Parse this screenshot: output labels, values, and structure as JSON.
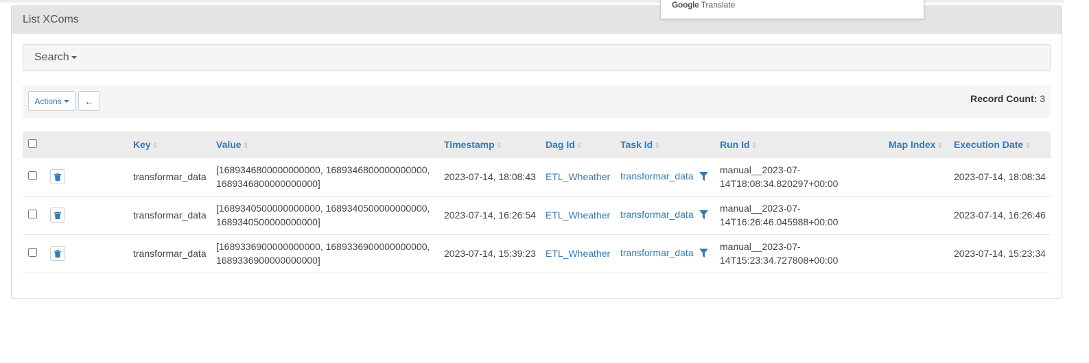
{
  "panel": {
    "title": "List XComs"
  },
  "search": {
    "label": "Search"
  },
  "toolbar": {
    "actions_label": "Actions",
    "back_label": "←",
    "record_count_label": "Record Count:",
    "record_count_value": "3"
  },
  "popup": {
    "google": "Google",
    "translate": "Translate"
  },
  "table": {
    "columns": [
      "Key",
      "Value",
      "Timestamp",
      "Dag Id",
      "Task Id",
      "Run Id",
      "Map Index",
      "Execution Date"
    ],
    "rows": [
      {
        "key": "transformar_data",
        "value_line1": "[1689346800000000000, 1689346800000000000,",
        "value_line2": "1689346800000000000]",
        "timestamp": "2023-07-14, 18:08:43",
        "dag_id": "ETL_Wheather",
        "task_id": "transformar_data",
        "run_id_line1": "manual__2023-07-",
        "run_id_line2": "14T18:08:34.820297+00:00",
        "map_index": "",
        "execution_date": "2023-07-14, 18:08:34"
      },
      {
        "key": "transformar_data",
        "value_line1": "[1689340500000000000, 1689340500000000000,",
        "value_line2": "1689340500000000000]",
        "timestamp": "2023-07-14, 16:26:54",
        "dag_id": "ETL_Wheather",
        "task_id": "transformar_data",
        "run_id_line1": "manual__2023-07-",
        "run_id_line2": "14T16:26:46.045988+00:00",
        "map_index": "",
        "execution_date": "2023-07-14, 16:26:46"
      },
      {
        "key": "transformar_data",
        "value_line1": "[1689336900000000000, 1689336900000000000,",
        "value_line2": "1689336900000000000]",
        "timestamp": "2023-07-14, 15:39:23",
        "dag_id": "ETL_Wheather",
        "task_id": "transformar_data",
        "run_id_line1": "manual__2023-07-",
        "run_id_line2": "14T15:23:34.727808+00:00",
        "map_index": "",
        "execution_date": "2023-07-14, 15:23:34"
      }
    ]
  }
}
